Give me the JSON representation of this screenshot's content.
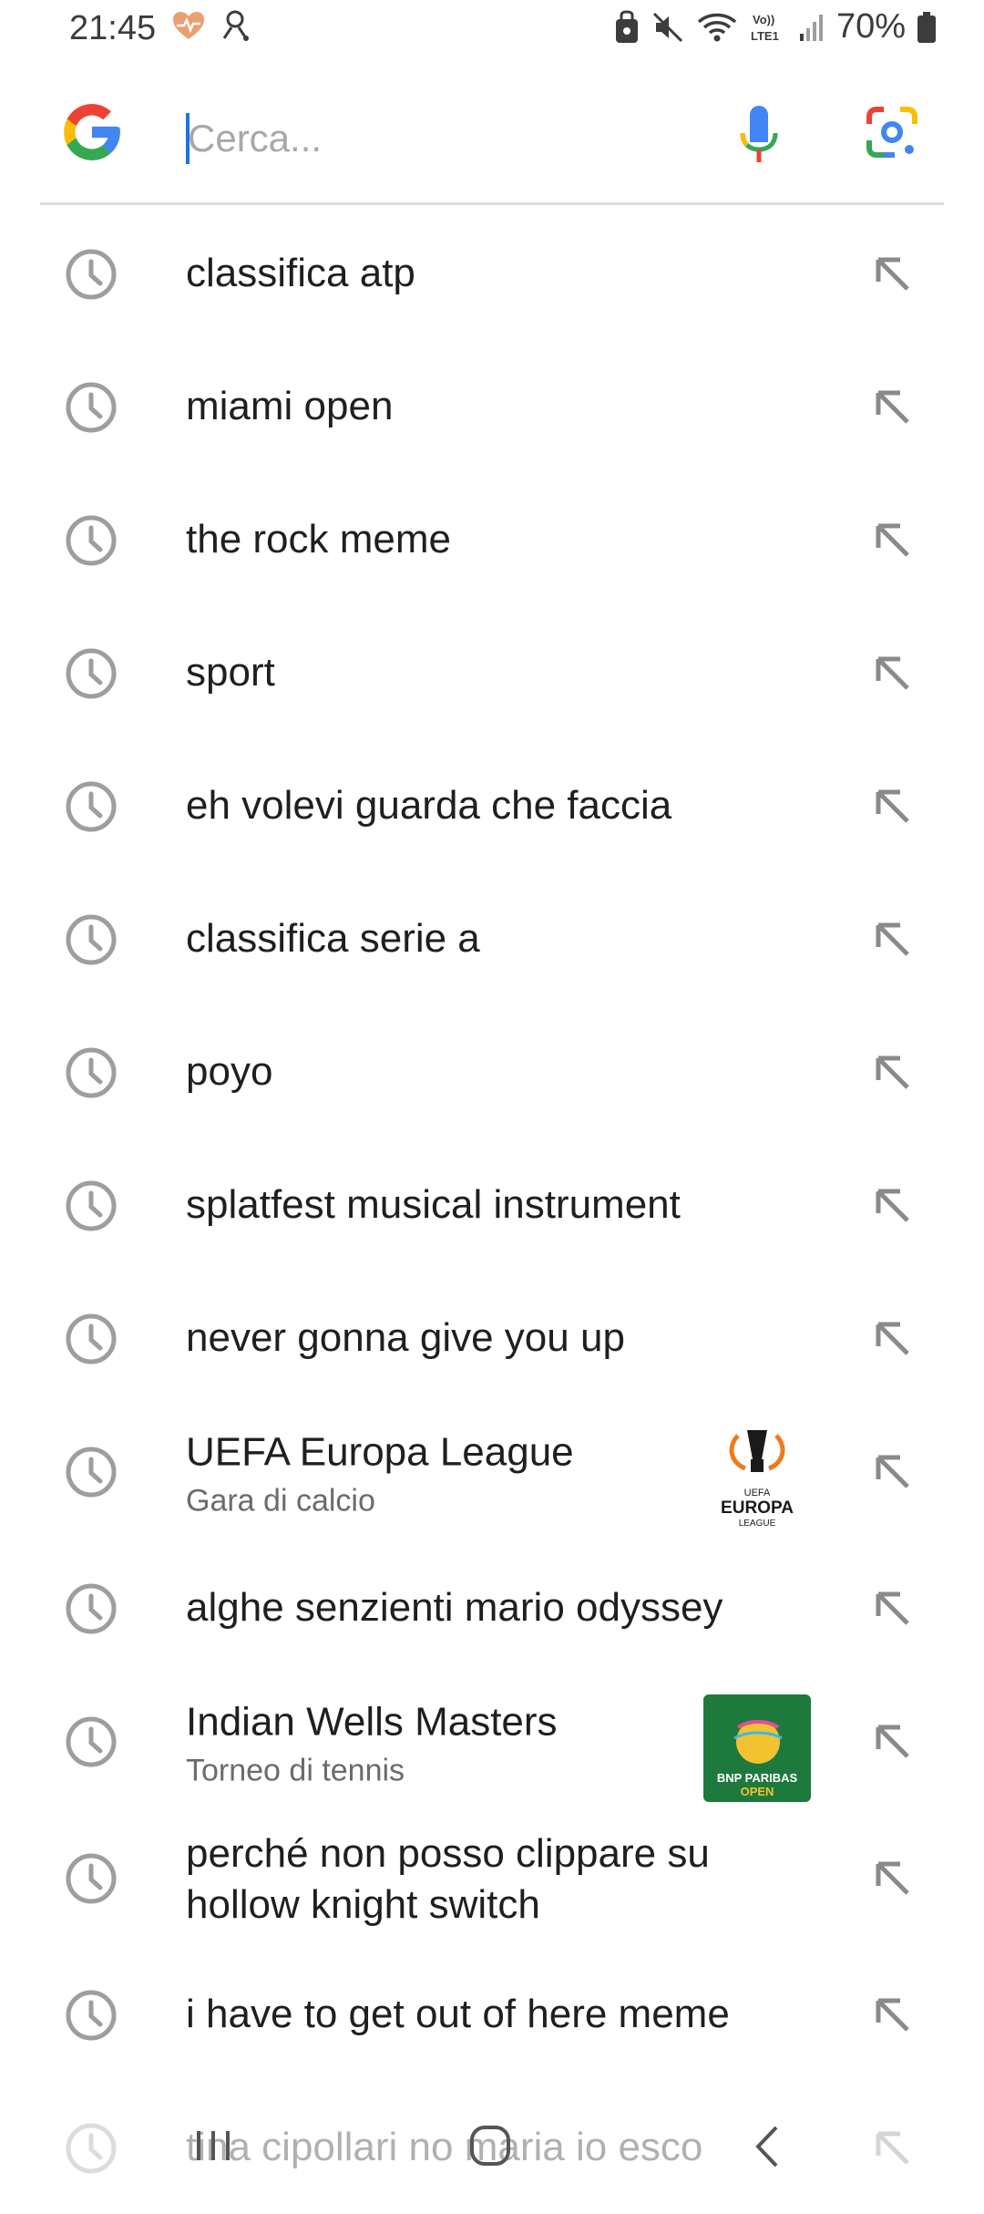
{
  "status_bar": {
    "time": "21:45",
    "battery_text": "70%"
  },
  "search": {
    "placeholder": "Cerca..."
  },
  "history": [
    {
      "title": "classifica atp"
    },
    {
      "title": "miami open"
    },
    {
      "title": "the rock meme"
    },
    {
      "title": "sport"
    },
    {
      "title": "eh volevi guarda che faccia"
    },
    {
      "title": "classifica serie a"
    },
    {
      "title": "poyo"
    },
    {
      "title": "splatfest musical instrument"
    },
    {
      "title": "never gonna give you up"
    },
    {
      "title": "UEFA Europa League",
      "subtitle": "Gara di calcio",
      "thumb_text": [
        "UEFA",
        "EUROPA",
        "LEAGUE"
      ]
    },
    {
      "title": "alghe senzienti mario odyssey"
    },
    {
      "title": "Indian Wells Masters",
      "subtitle": "Torneo di tennis",
      "thumb_text": [
        "BNP PARIBAS",
        "OPEN"
      ]
    },
    {
      "title": "perché non posso clippare su hollow knight switch"
    },
    {
      "title": "i have to get out of here meme"
    },
    {
      "title": "tina cipollari no maria io esco"
    }
  ],
  "colors": {
    "google_blue": "#4285F4",
    "google_red": "#EA4335",
    "google_yellow": "#FBBC05",
    "google_green": "#34A853",
    "icon_gray": "#9e9e9e"
  }
}
